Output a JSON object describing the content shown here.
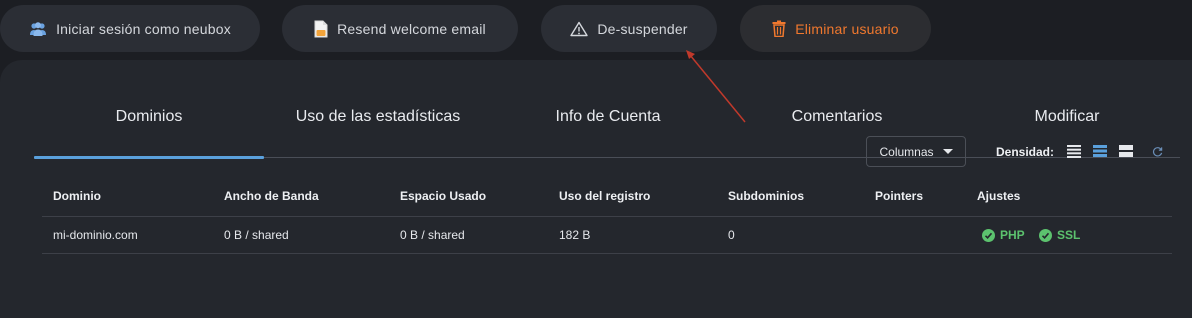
{
  "toolbar": {
    "login_as": {
      "label": "Iniciar sesión como neubox",
      "icon": "users-icon"
    },
    "resend": {
      "label": "Resend welcome email",
      "icon": "document-icon"
    },
    "unsuspend": {
      "label": "De-suspender",
      "icon": "warning-icon"
    },
    "delete": {
      "label": "Eliminar usuario",
      "icon": "trash-icon",
      "color": "#f0782e"
    }
  },
  "tabs": [
    {
      "label": "Dominios",
      "active": true
    },
    {
      "label": "Uso de las estadísticas"
    },
    {
      "label": "Info de Cuenta"
    },
    {
      "label": "Comentarios"
    },
    {
      "label": "Modificar"
    }
  ],
  "table_controls": {
    "columns_label": "Columnas",
    "density_label": "Densidad:",
    "density_options": [
      "compact-density-icon",
      "standard-density-icon",
      "comfortable-density-icon"
    ],
    "density_selected": "standard-density-icon"
  },
  "table": {
    "headers": [
      "Dominio",
      "Ancho de Banda",
      "Espacio Usado",
      "Uso del registro",
      "Subdominios",
      "Pointers",
      "Ajustes"
    ],
    "rows": [
      {
        "dominio": "mi-dominio.com",
        "ancho": "0 B / shared",
        "espacio": "0 B / shared",
        "registro": "182 B",
        "subdominios": "0",
        "pointers": "",
        "ajustes": [
          "PHP",
          "SSL"
        ]
      }
    ]
  },
  "colors": {
    "accent": "#5aa0dc",
    "success": "#5cc26e",
    "danger": "#f0782e",
    "annotation": "#c0392b"
  }
}
